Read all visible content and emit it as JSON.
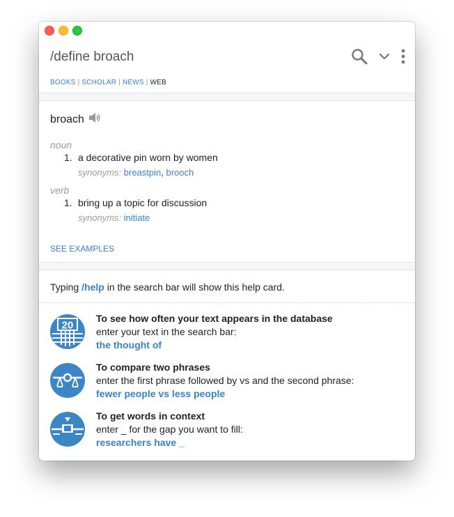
{
  "header": {
    "query": "/define broach",
    "sources": [
      {
        "label": "BOOKS",
        "active": false
      },
      {
        "label": "SCHOLAR",
        "active": false
      },
      {
        "label": "NEWS",
        "active": false
      },
      {
        "label": "WEB",
        "active": true
      }
    ],
    "separator": "|",
    "icons": [
      "search-icon",
      "chevron-down-icon",
      "more-vertical-icon"
    ]
  },
  "definition": {
    "word": "broach",
    "speaker_icon": "speaker-icon",
    "entries": [
      {
        "pos": "noun",
        "number": "1.",
        "sense": "a decorative pin worn by women",
        "synonyms_label": "synonyms:",
        "synonyms": [
          "breastpin",
          "brooch"
        ]
      },
      {
        "pos": "verb",
        "number": "1.",
        "sense": "bring up a topic for discussion",
        "synonyms_label": "synonyms:",
        "synonyms": [
          "initiate"
        ]
      }
    ],
    "see_examples": "SEE EXAMPLES"
  },
  "help": {
    "intro_before": "Typing ",
    "intro_cmd": "/help",
    "intro_after": " in the search bar will show this help card.",
    "tips": [
      {
        "icon": "frequency-chart-icon",
        "badge": "20",
        "title": "To see how often your text appears in the database",
        "text": "enter your text in the search bar:",
        "example": "the thought of"
      },
      {
        "icon": "balance-scale-icon",
        "title": "To compare two phrases",
        "text": "enter the first phrase followed by vs and the second phrase:",
        "example": "fewer people vs less people"
      },
      {
        "icon": "gap-fill-icon",
        "title": "To get words in context",
        "text": "enter _ for the gap you want to fill:",
        "example": "researchers have _"
      }
    ]
  },
  "colors": {
    "accent": "#3b82c4",
    "icon_circle": "#3d86c6",
    "muted": "#9a9a9a"
  }
}
